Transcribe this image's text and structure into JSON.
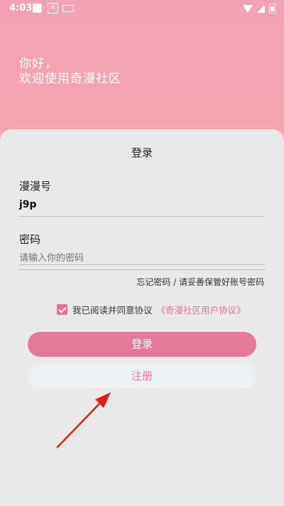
{
  "status_bar": {
    "time": "4:03",
    "notif_a": "A"
  },
  "greeting": {
    "line1": "你好，",
    "line2": "欢迎使用奇漫社区"
  },
  "card": {
    "title": "登录",
    "account_label": "漫漫号",
    "account_value": "j9p",
    "password_label": "密码",
    "password_placeholder": "请输入你的密码",
    "forgot": "忘记密码 / 请妥善保管好账号密码",
    "agree_text": "我已阅读并同意协议",
    "agree_link": "《奇漫社区用户协议》",
    "login_button": "登录",
    "register_button": "注册"
  },
  "colors": {
    "accent": "#e5799b",
    "background_top": "#f2a2b4",
    "annotation_arrow": "#e01c1c"
  }
}
